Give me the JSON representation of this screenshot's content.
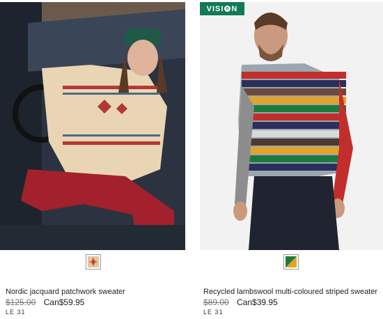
{
  "products": [
    {
      "name": "Nordic jacquard patchwork sweater",
      "price_original": "$125.00",
      "price_sale": "Can$59.95",
      "sku": "LE 31",
      "badge": "",
      "swatch_colors": [
        "#e7c49a",
        "#c0423a"
      ]
    },
    {
      "name": "Recycled lambswool multi-coloured striped sweater",
      "price_original": "$89.00",
      "price_sale": "Can$39.95",
      "sku": "LE 31",
      "badge_left": "VISI",
      "badge_right": "N",
      "badge_o": "o",
      "swatch_colors": [
        "#1d7a3a",
        "#e3a32a"
      ]
    }
  ]
}
